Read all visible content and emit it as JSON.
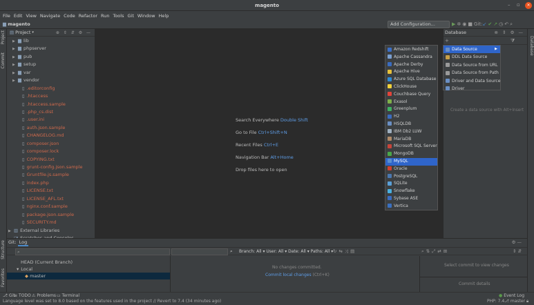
{
  "window": {
    "title": "magento",
    "controls": [
      "–",
      "▫",
      "×"
    ]
  },
  "menu": [
    "File",
    "Edit",
    "View",
    "Navigate",
    "Code",
    "Refactor",
    "Run",
    "Tools",
    "Git",
    "Window",
    "Help"
  ],
  "navbar": {
    "project": "magento",
    "run_config": "Add Configuration...",
    "git_label": "Git:"
  },
  "left_tabs": [
    "Project",
    "Commit",
    "Structure",
    "Favorites"
  ],
  "right_tabs": [
    "Database"
  ],
  "project_panel": {
    "header": "Project",
    "tree": [
      {
        "label": "lib",
        "type": "folder",
        "arrow": "▶",
        "color": "norm",
        "indent": 1
      },
      {
        "label": "phpserver",
        "type": "folder",
        "arrow": "▶",
        "color": "norm",
        "indent": 1
      },
      {
        "label": "pub",
        "type": "folder",
        "arrow": "▶",
        "color": "norm",
        "indent": 1
      },
      {
        "label": "setup",
        "type": "folder",
        "arrow": "▶",
        "color": "norm",
        "indent": 1
      },
      {
        "label": "var",
        "type": "folder",
        "arrow": "▶",
        "color": "norm",
        "indent": 1
      },
      {
        "label": "vendor",
        "type": "folder",
        "arrow": "▶",
        "color": "norm",
        "indent": 1
      },
      {
        "label": ".editorconfig",
        "type": "file",
        "color": "red",
        "indent": 2
      },
      {
        "label": ".htaccess",
        "type": "file",
        "color": "red",
        "indent": 2
      },
      {
        "label": ".htaccess.sample",
        "type": "file",
        "color": "red",
        "indent": 2
      },
      {
        "label": ".php_cs.dist",
        "type": "file",
        "color": "red",
        "indent": 2
      },
      {
        "label": ".user.ini",
        "type": "file",
        "color": "red",
        "indent": 2
      },
      {
        "label": "auth.json.sample",
        "type": "file",
        "color": "red",
        "indent": 2
      },
      {
        "label": "CHANGELOG.md",
        "type": "file",
        "color": "red",
        "indent": 2
      },
      {
        "label": "composer.json",
        "type": "file",
        "color": "red",
        "indent": 2
      },
      {
        "label": "composer.lock",
        "type": "file",
        "color": "red",
        "indent": 2
      },
      {
        "label": "COPYING.txt",
        "type": "file",
        "color": "red",
        "indent": 2
      },
      {
        "label": "grunt-config.json.sample",
        "type": "file",
        "color": "red",
        "indent": 2
      },
      {
        "label": "Gruntfile.js.sample",
        "type": "file",
        "color": "red",
        "indent": 2
      },
      {
        "label": "index.php",
        "type": "file",
        "color": "red",
        "indent": 2
      },
      {
        "label": "LICENSE.txt",
        "type": "file",
        "color": "red",
        "indent": 2
      },
      {
        "label": "LICENSE_AFL.txt",
        "type": "file",
        "color": "red",
        "indent": 2
      },
      {
        "label": "nginx.conf.sample",
        "type": "file",
        "color": "red",
        "indent": 2
      },
      {
        "label": "package.json.sample",
        "type": "file",
        "color": "red",
        "indent": 2
      },
      {
        "label": "SECURITY.md",
        "type": "file",
        "color": "red",
        "indent": 2
      },
      {
        "label": "External Libraries",
        "type": "lib",
        "arrow": "▶",
        "color": "norm",
        "indent": 0
      },
      {
        "label": "Scratches and Consoles",
        "type": "scratch",
        "arrow": "",
        "color": "norm",
        "indent": 0
      }
    ]
  },
  "editor_hints": [
    {
      "text": "Search Everywhere",
      "key": "Double Shift"
    },
    {
      "text": "Go to File",
      "key": "Ctrl+Shift+N"
    },
    {
      "text": "Recent Files",
      "key": "Ctrl+E"
    },
    {
      "text": "Navigation Bar",
      "key": "Alt+Home"
    },
    {
      "text": "Drop files here to open",
      "key": ""
    }
  ],
  "database_panel": {
    "header": "Database",
    "empty_text": "Create a data source with Alt+Insert"
  },
  "add_menu": [
    {
      "label": "Data Source",
      "icon_color": "#6a8fc4",
      "selected": true,
      "arrow": "▶"
    },
    {
      "label": "DDL Data Source",
      "icon_color": "#c8a048",
      "selected": false,
      "arrow": ""
    },
    {
      "label": "Data Source from URL",
      "icon_color": "#9a9a9a",
      "selected": false,
      "arrow": ""
    },
    {
      "label": "Data Source from Path",
      "icon_color": "#9a9a9a",
      "selected": false,
      "arrow": ""
    },
    {
      "label": "Driver and Data Source",
      "icon_color": "#6a8fc4",
      "selected": false,
      "arrow": ""
    },
    {
      "label": "Driver",
      "icon_color": "#6a8fc4",
      "selected": false,
      "arrow": ""
    }
  ],
  "datasource_menu": [
    {
      "label": "Amazon Redshift",
      "icon_color": "#3b6fc6"
    },
    {
      "label": "Apache Cassandra",
      "icon_color": "#7a9fd0"
    },
    {
      "label": "Apache Derby",
      "icon_color": "#3a6cc0"
    },
    {
      "label": "Apache Hive",
      "icon_color": "#e6c03a"
    },
    {
      "label": "Azure SQL Database",
      "icon_color": "#2d8ad6"
    },
    {
      "label": "ClickHouse",
      "icon_color": "#f3d23a"
    },
    {
      "label": "Couchbase Query",
      "icon_color": "#e2443a"
    },
    {
      "label": "Exasol",
      "icon_color": "#7fb04a"
    },
    {
      "label": "Greenplum",
      "icon_color": "#3fb062"
    },
    {
      "label": "H2",
      "icon_color": "#3a6cc0"
    },
    {
      "label": "HSQLDB",
      "icon_color": "#6a8fc4"
    },
    {
      "label": "IBM Db2 LUW",
      "icon_color": "#9fb0c0"
    },
    {
      "label": "MariaDB",
      "icon_color": "#b08a68"
    },
    {
      "label": "Microsoft SQL Server",
      "icon_color": "#c8453a"
    },
    {
      "label": "MongoDB",
      "icon_color": "#4aa84a"
    },
    {
      "label": "MySQL",
      "icon_color": "#5a8fd0",
      "selected": true
    },
    {
      "label": "Oracle",
      "icon_color": "#d04030"
    },
    {
      "label": "PostgreSQL",
      "icon_color": "#4a78b0"
    },
    {
      "label": "SQLite",
      "icon_color": "#5aa0d8"
    },
    {
      "label": "Snowflake",
      "icon_color": "#4ab0e0"
    },
    {
      "label": "Sybase ASE",
      "icon_color": "#3a6cc0"
    },
    {
      "label": "Vertica",
      "icon_color": "#3a70c0"
    }
  ],
  "git_panel": {
    "tabs": [
      "Git:",
      "Log"
    ],
    "filters": "Branch: All ▾  User: All ▾  Date: All ▾  Paths: All ▾",
    "branches": [
      {
        "label": "HEAD (Current Branch)",
        "indent": 1,
        "selected": false
      },
      {
        "label": "Local",
        "indent": 0,
        "selected": false,
        "arrow": "▾"
      },
      {
        "label": "master",
        "indent": 2,
        "selected": true
      }
    ],
    "no_changes": "No changes committed.",
    "commit_link": "Commit local changes",
    "commit_shortcut": "(Ctrl+K)",
    "select_commit": "Select commit to view changes",
    "commit_details": "Commit details"
  },
  "bottom_tabs": [
    {
      "label": "Git",
      "icon": "⎇"
    },
    {
      "label": "TODO",
      "icon": "≡"
    },
    {
      "label": "Problems",
      "icon": "⚠"
    },
    {
      "label": "Terminal",
      "icon": "▭"
    }
  ],
  "event_log": "Event Log",
  "status": {
    "message": "Language level was set to 8.0 based on the features used in the project // Revert to 7.4 (34 minutes ago)",
    "php": "PHP: 7.4",
    "branch": "master"
  }
}
